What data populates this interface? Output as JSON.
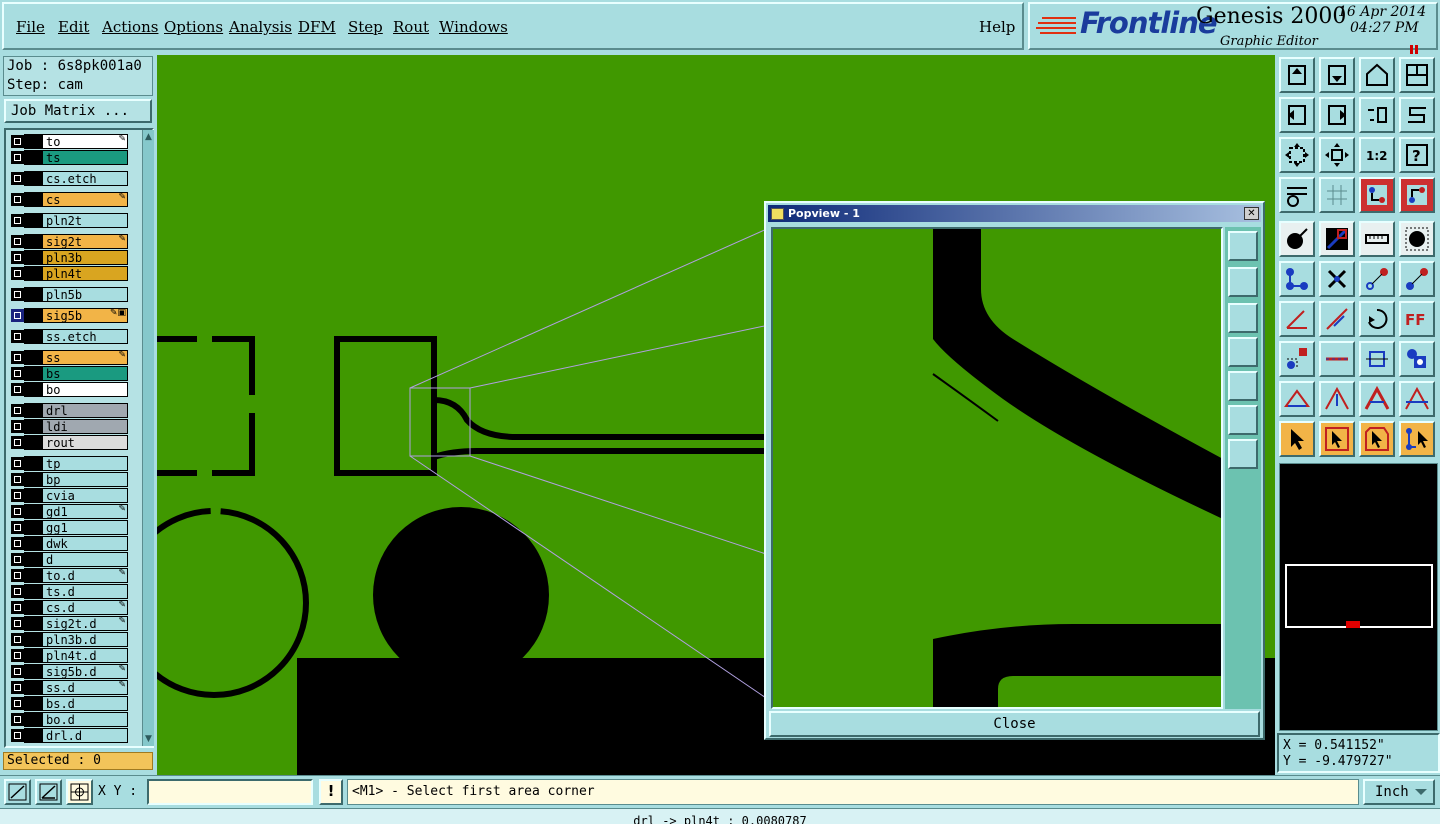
{
  "menu": {
    "file": "File",
    "edit": "Edit",
    "actions": "Actions",
    "options": "Options",
    "analysis": "Analysis",
    "dfm": "DFM",
    "step": "Step",
    "rout": "Rout",
    "windows": "Windows",
    "help": "Help"
  },
  "brand": {
    "logo": "Frontline",
    "product": "Genesis 2000",
    "subtitle": "Graphic Editor",
    "date": "16 Apr 2014",
    "time": "04:27 PM"
  },
  "job": {
    "job_line": "Job : 6s8pk001a0",
    "step_line": "Step: cam",
    "matrix_button": "Job Matrix ..."
  },
  "layers": [
    {
      "name": "to",
      "color": "#ffffff",
      "flag": "✎"
    },
    {
      "name": "ts",
      "color": "#1a9a80",
      "flag": ""
    },
    {
      "name": "cs.etch",
      "color": "#a8dde0",
      "flag": ""
    },
    {
      "name": "cs",
      "color": "#f2b447",
      "flag": "✎"
    },
    {
      "name": "pln2t",
      "color": "#a8dde0",
      "flag": ""
    },
    {
      "name": "sig2t",
      "color": "#f2b447",
      "flag": "✎"
    },
    {
      "name": "pln3b",
      "color": "#d9a520",
      "flag": ""
    },
    {
      "name": "pln4t",
      "color": "#d9a520",
      "flag": ""
    },
    {
      "name": "pln5b",
      "color": "#a8dde0",
      "flag": ""
    },
    {
      "name": "sig5b",
      "color": "#f2b447",
      "flag": "✎▣"
    },
    {
      "name": "ss.etch",
      "color": "#a8dde0",
      "flag": ""
    },
    {
      "name": "ss",
      "color": "#f2b447",
      "flag": "✎"
    },
    {
      "name": "bs",
      "color": "#1a9a80",
      "flag": ""
    },
    {
      "name": "bo",
      "color": "#ffffff",
      "flag": ""
    },
    {
      "name": "drl",
      "color": "#a0a8b0",
      "flag": ""
    },
    {
      "name": "ldi",
      "color": "#a0a8b0",
      "flag": ""
    },
    {
      "name": "rout",
      "color": "#dcdcdc",
      "flag": ""
    },
    {
      "name": "tp",
      "color": "#a8dde0",
      "flag": ""
    },
    {
      "name": "bp",
      "color": "#a8dde0",
      "flag": ""
    },
    {
      "name": "cvia",
      "color": "#a8dde0",
      "flag": ""
    },
    {
      "name": "gd1",
      "color": "#a8dde0",
      "flag": "✎"
    },
    {
      "name": "gg1",
      "color": "#a8dde0",
      "flag": ""
    },
    {
      "name": "dwk",
      "color": "#a8dde0",
      "flag": ""
    },
    {
      "name": "d",
      "color": "#a8dde0",
      "flag": ""
    },
    {
      "name": "to.d",
      "color": "#a8dde0",
      "flag": "✎"
    },
    {
      "name": "ts.d",
      "color": "#a8dde0",
      "flag": ""
    },
    {
      "name": "cs.d",
      "color": "#a8dde0",
      "flag": "✎"
    },
    {
      "name": "sig2t.d",
      "color": "#a8dde0",
      "flag": "✎"
    },
    {
      "name": "pln3b.d",
      "color": "#a8dde0",
      "flag": ""
    },
    {
      "name": "pln4t.d",
      "color": "#a8dde0",
      "flag": ""
    },
    {
      "name": "sig5b.d",
      "color": "#a8dde0",
      "flag": "✎"
    },
    {
      "name": "ss.d",
      "color": "#a8dde0",
      "flag": "✎"
    },
    {
      "name": "bs.d",
      "color": "#a8dde0",
      "flag": ""
    },
    {
      "name": "bo.d",
      "color": "#a8dde0",
      "flag": ""
    },
    {
      "name": "drl.d",
      "color": "#a8dde0",
      "flag": ""
    }
  ],
  "selected": "Selected : 0",
  "popview": {
    "title": "Popview - 1",
    "close_label": "Close"
  },
  "coords": {
    "x": "X = 0.541152\"",
    "y": "Y = -9.479727\""
  },
  "bottom": {
    "xy_label": "X Y :",
    "xy_value": "",
    "warn": "!",
    "prompt": "<M1> - Select first area corner",
    "units": "Inch"
  },
  "status": "drl -> pln4t : 0.0080787",
  "colors": {
    "board": "#409800",
    "copper": "#000000",
    "panel": "#a8dde0"
  }
}
